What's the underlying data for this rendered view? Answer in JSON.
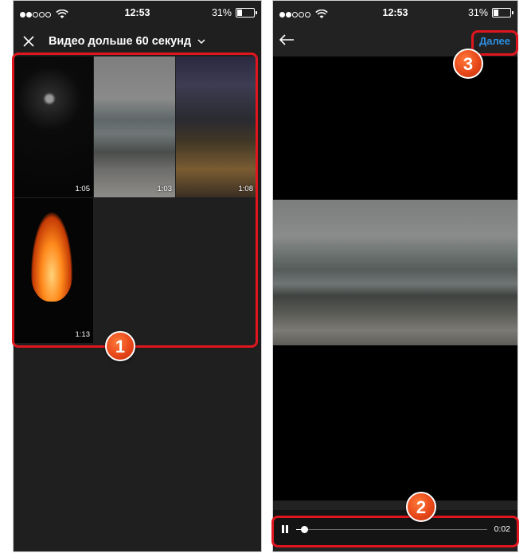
{
  "left_screen": {
    "status_bar": {
      "time": "12:53",
      "battery": "31%",
      "battery_level": 0.31,
      "signal_filled": 2,
      "signal_total": 5
    },
    "header": {
      "title": "Видео дольше 60 секунд",
      "close_icon": "close-icon",
      "dropdown_icon": "chevron-down-icon"
    },
    "videos": [
      {
        "duration": "1:05"
      },
      {
        "duration": "1:03"
      },
      {
        "duration": "1:08"
      },
      {
        "duration": "1:13"
      }
    ]
  },
  "right_screen": {
    "status_bar": {
      "time": "12:53",
      "battery": "31%",
      "battery_level": 0.31,
      "signal_filled": 2,
      "signal_total": 5
    },
    "header": {
      "back_icon": "arrow-left-icon",
      "next_label": "Далее"
    },
    "player": {
      "current_time": "0:02",
      "progress": 0.04,
      "pause_icon": "pause-icon"
    }
  },
  "callouts": [
    "1",
    "2",
    "3"
  ],
  "colors": {
    "accent_red": "#e0161e",
    "badge_orange": "#e8481a",
    "link_blue": "#2d8fe0"
  }
}
